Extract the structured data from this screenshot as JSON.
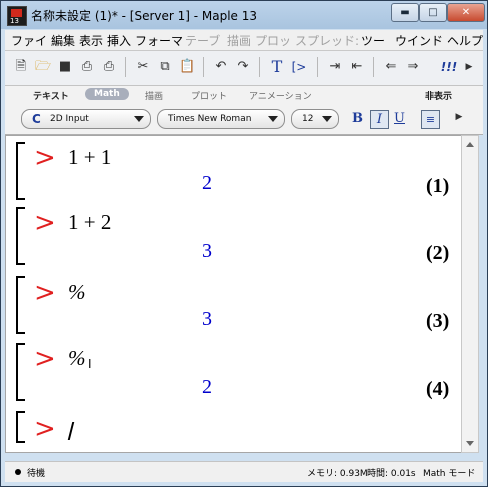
{
  "window": {
    "title": "名称未設定 (1)* - [Server 1] - Maple 13",
    "app_icon": "maple-leaf-icon",
    "app_icon_label": "13",
    "controls": [
      "minimize-icon",
      "maximize-icon",
      "close-icon"
    ]
  },
  "menubar": {
    "items": [
      {
        "label": "ファイ",
        "enabled": true
      },
      {
        "label": "編集",
        "enabled": true
      },
      {
        "label": "表示",
        "enabled": true
      },
      {
        "label": "挿入",
        "enabled": true
      },
      {
        "label": "フォーマ",
        "enabled": true
      },
      {
        "label": "テーブ",
        "enabled": false
      },
      {
        "label": "描画",
        "enabled": false
      },
      {
        "label": "プロッ",
        "enabled": false
      },
      {
        "label": "スプレッド:",
        "enabled": false
      },
      {
        "label": "ツー",
        "enabled": true
      },
      {
        "label": "ウインド",
        "enabled": true
      },
      {
        "label": "ヘルプ",
        "enabled": true
      }
    ]
  },
  "toolbar": {
    "icons": [
      "new-document-icon",
      "open-folder-icon",
      "save-icon",
      "print-preview-icon",
      "print-icon",
      "cut-icon",
      "copy-icon",
      "paste-icon",
      "undo-icon",
      "redo-icon",
      "text-mode-icon",
      "math-mode-icon",
      "indent-icon",
      "outdent-icon",
      "back-icon",
      "forward-icon",
      "execute-all-icon"
    ],
    "text_icon_glyph": "T",
    "math_icon_glyph": "[>",
    "execute_glyph": "!!!"
  },
  "context_bar": {
    "tabs": [
      {
        "label": "テキスト",
        "active": false
      },
      {
        "label": "Math",
        "active": true
      },
      {
        "label": "描画",
        "active": false
      },
      {
        "label": "プロット",
        "active": false
      },
      {
        "label": "アニメーション",
        "active": false
      }
    ],
    "hide_label": "非表示",
    "input_mode": "2D Input",
    "input_mode_prefix": "C",
    "font": "Times New Roman",
    "size": "12",
    "bold": "B",
    "italic": "I",
    "underline": "U"
  },
  "worksheet": {
    "groups": [
      {
        "prompt": ">",
        "input": "1 + 1",
        "output": "2",
        "label": "(1)"
      },
      {
        "prompt": ">",
        "input": "1 + 2",
        "output": "3",
        "label": "(2)"
      },
      {
        "prompt": ">",
        "input": "%",
        "output": "3",
        "label": "(3)"
      },
      {
        "prompt": ">",
        "input": "%",
        "output": "2",
        "label": "(4)"
      },
      {
        "prompt": ">",
        "input": "",
        "output": "",
        "label": ""
      }
    ]
  },
  "statusbar": {
    "state": "待機",
    "memory": "メモリ: 0.93M",
    "time": "時間: 0.01s",
    "mode": "Math モード"
  }
}
